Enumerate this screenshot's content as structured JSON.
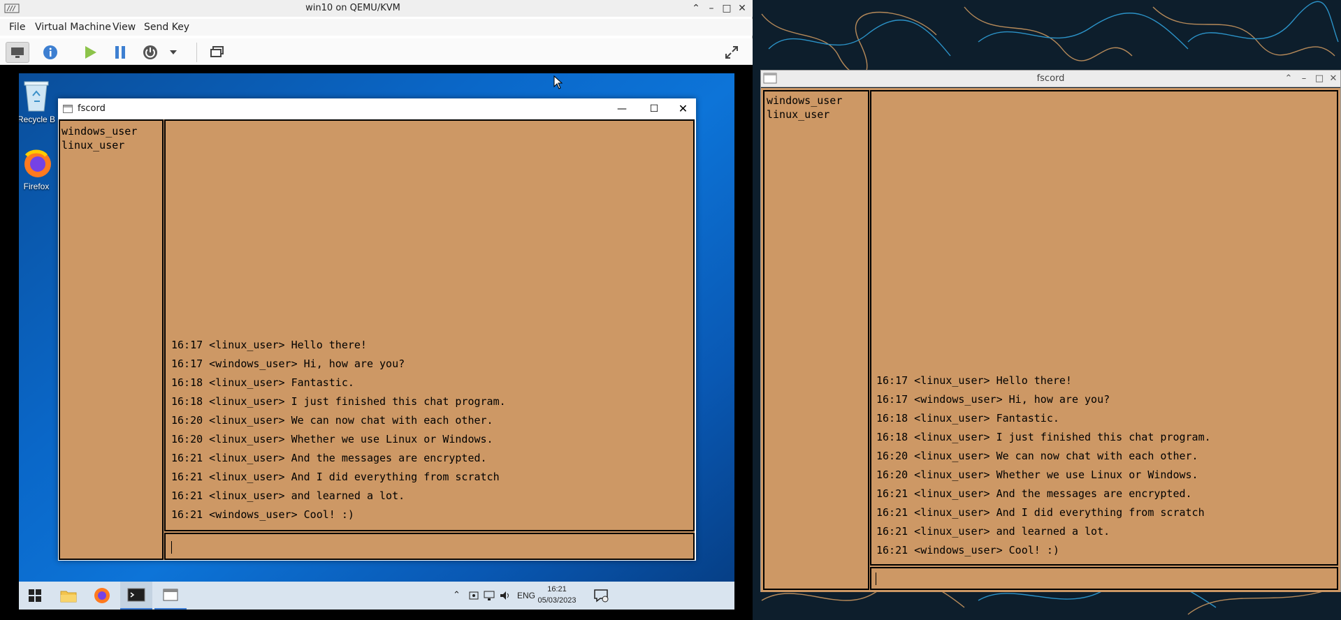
{
  "vm": {
    "title": "win10 on QEMU/KVM",
    "menu": [
      "File",
      "Virtual Machine",
      "View",
      "Send Key"
    ]
  },
  "guest": {
    "desktop_icons": [
      "Recycle B",
      "Firefox"
    ],
    "tray": {
      "lang": "ENG",
      "time": "16:21",
      "date": "05/03/2023"
    }
  },
  "fscord": {
    "title": "fscord",
    "users": [
      "windows_user",
      "linux_user"
    ],
    "messages": [
      "16:17 <linux_user> Hello there!",
      "16:17 <windows_user> Hi, how are you?",
      "16:18 <linux_user> Fantastic.",
      "16:18 <linux_user> I just finished this chat program.",
      "16:20 <linux_user> We can now chat with each other.",
      "16:20 <linux_user> Whether we use Linux or Windows.",
      "16:21 <linux_user> And the messages are encrypted.",
      "16:21 <linux_user> And I did everything from scratch",
      "16:21 <linux_user> and learned a lot.",
      "16:21 <windows_user> Cool! :)"
    ]
  },
  "colors": {
    "fscord_bg": "#cd9865",
    "win_blue": "#0a67c8"
  }
}
